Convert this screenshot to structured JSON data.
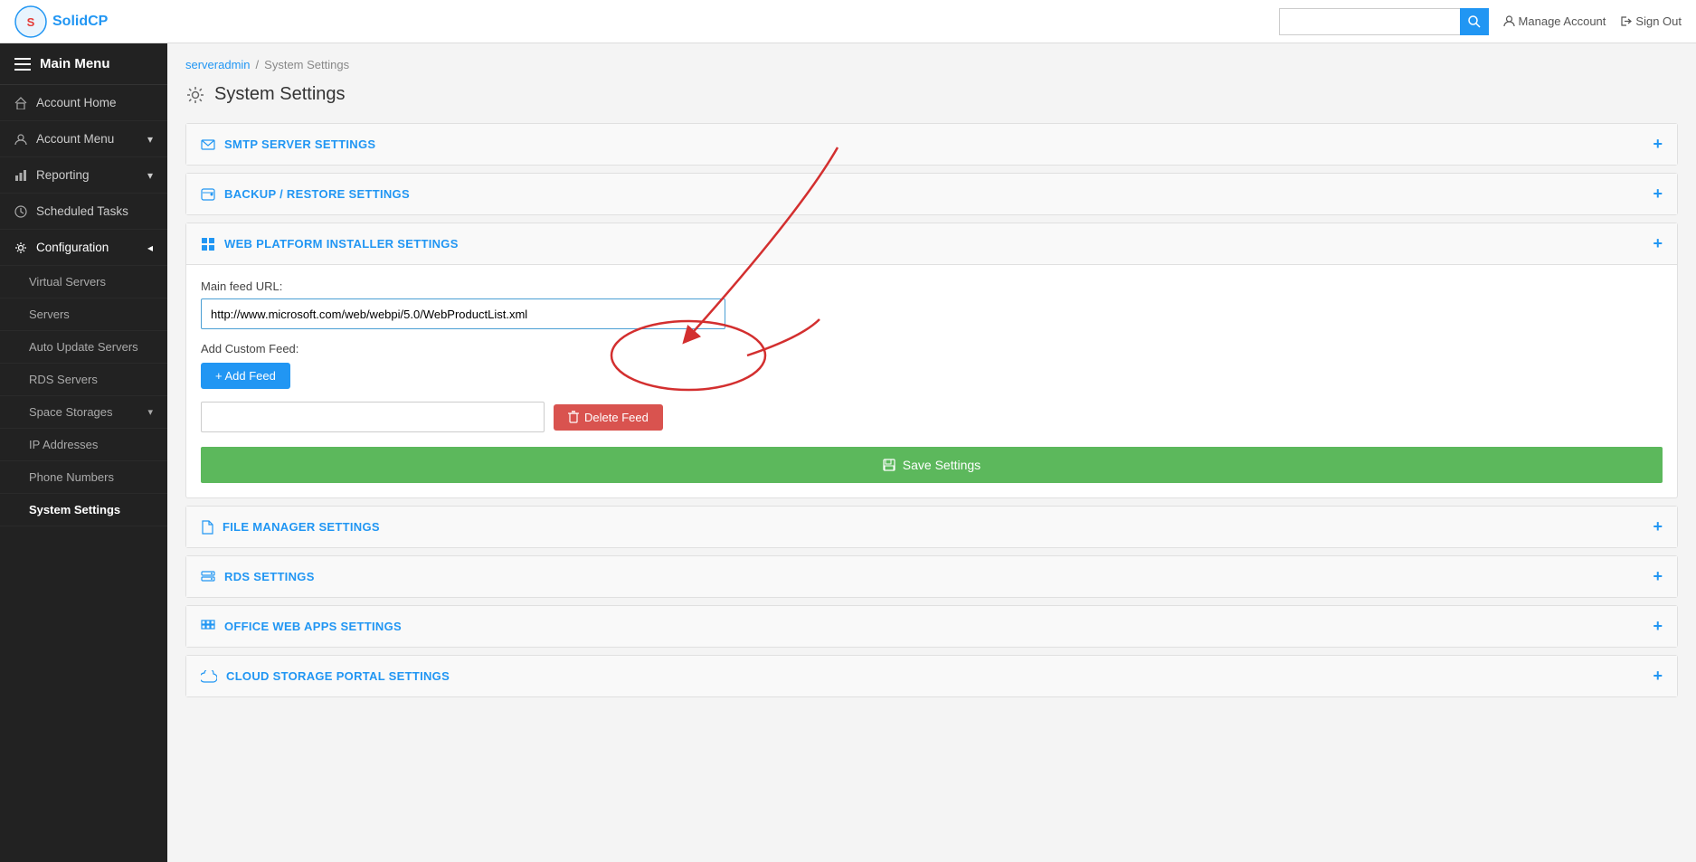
{
  "topNav": {
    "logoAlt": "SolidCP",
    "searchPlaceholder": "",
    "manageAccount": "Manage Account",
    "signOut": "Sign Out"
  },
  "sidebar": {
    "mainMenuLabel": "Main Menu",
    "items": [
      {
        "id": "account-home",
        "label": "Account Home",
        "icon": "home",
        "hasChevron": false,
        "active": false
      },
      {
        "id": "account-menu",
        "label": "Account Menu",
        "icon": "user",
        "hasChevron": true,
        "active": false
      },
      {
        "id": "reporting",
        "label": "Reporting",
        "icon": "bar-chart",
        "hasChevron": true,
        "active": false
      },
      {
        "id": "scheduled-tasks",
        "label": "Scheduled Tasks",
        "icon": "clock",
        "hasChevron": false,
        "active": false
      },
      {
        "id": "configuration",
        "label": "Configuration",
        "icon": "cog",
        "hasChevron": true,
        "active": true,
        "expanded": true
      }
    ],
    "configSubItems": [
      {
        "id": "virtual-servers",
        "label": "Virtual Servers",
        "active": false
      },
      {
        "id": "servers",
        "label": "Servers",
        "active": false
      },
      {
        "id": "auto-update-servers",
        "label": "Auto Update Servers",
        "active": false
      },
      {
        "id": "rds-servers",
        "label": "RDS Servers",
        "active": false
      },
      {
        "id": "space-storages",
        "label": "Space Storages",
        "icon": "chevron",
        "active": false
      },
      {
        "id": "ip-addresses",
        "label": "IP Addresses",
        "active": false
      },
      {
        "id": "phone-numbers",
        "label": "Phone Numbers",
        "active": false
      },
      {
        "id": "system-settings",
        "label": "System Settings",
        "active": true
      }
    ]
  },
  "breadcrumb": {
    "items": [
      {
        "label": "serveradmin",
        "link": true
      },
      {
        "label": "System Settings",
        "link": false
      }
    ]
  },
  "pageTitle": "System Settings",
  "sections": [
    {
      "id": "smtp",
      "icon": "envelope",
      "title": "SMTP SERVER SETTINGS",
      "expanded": false
    },
    {
      "id": "backup",
      "icon": "hdd",
      "title": "BACKUP / RESTORE SETTINGS",
      "expanded": false
    },
    {
      "id": "webpi",
      "icon": "windows",
      "title": "WEB PLATFORM INSTALLER SETTINGS",
      "expanded": true,
      "fields": {
        "mainFeedLabel": "Main feed URL:",
        "mainFeedValue": "http://www.microsoft.com/web/webpi/5.0/WebProductList.xml",
        "addCustomFeedLabel": "Add Custom Feed:",
        "addFeedButtonLabel": "+ Add Feed",
        "deleteFeedButtonLabel": "Delete Feed",
        "saveButtonLabel": "Save Settings"
      }
    },
    {
      "id": "filemanager",
      "icon": "file",
      "title": "FILE MANAGER SETTINGS",
      "expanded": false
    },
    {
      "id": "rds",
      "icon": "server",
      "title": "RDS SETTINGS",
      "expanded": false
    },
    {
      "id": "officewebapps",
      "icon": "grid",
      "title": "OFFICE WEB APPS SETTINGS",
      "expanded": false
    },
    {
      "id": "cloudstorage",
      "icon": "cloud",
      "title": "CLOUD STORAGE PORTAL SETTINGS",
      "expanded": false
    }
  ]
}
